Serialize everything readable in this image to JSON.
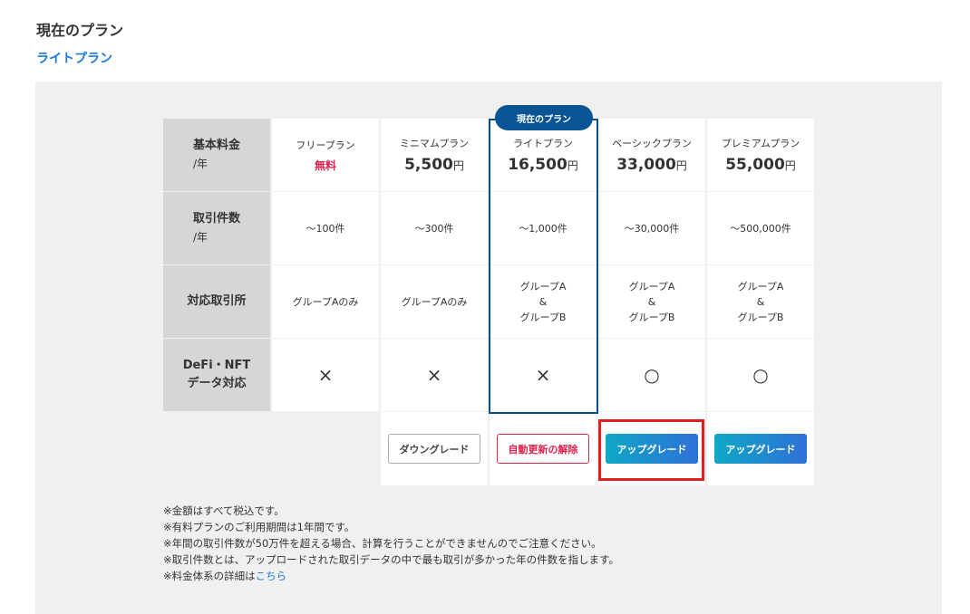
{
  "header": {
    "title": "現在のプラン",
    "current_plan": "ライトプラン"
  },
  "badge": "現在のプラン",
  "row_headers": {
    "base_fee": {
      "main": "基本料金",
      "sub": "/年"
    },
    "transactions": {
      "main": "取引件数",
      "sub": "/年"
    },
    "exchanges": {
      "main": "対応取引所"
    },
    "defi": {
      "line1": "DeFi・NFT",
      "line2": "データ対応"
    }
  },
  "plans": [
    {
      "name": "フリープラン",
      "price": "無料",
      "yen": "",
      "transactions": "〜100件",
      "exchanges": [
        "グループAのみ"
      ],
      "defi": "×"
    },
    {
      "name": "ミニマムプラン",
      "price": "5,500",
      "yen": "円",
      "transactions": "〜300件",
      "exchanges": [
        "グループAのみ"
      ],
      "defi": "×"
    },
    {
      "name": "ライトプラン",
      "price": "16,500",
      "yen": "円",
      "transactions": "〜1,000件",
      "exchanges": [
        "グループA",
        "&",
        "グループB"
      ],
      "defi": "×"
    },
    {
      "name": "ベーシックプラン",
      "price": "33,000",
      "yen": "円",
      "transactions": "〜30,000件",
      "exchanges": [
        "グループA",
        "&",
        "グループB"
      ],
      "defi": "○"
    },
    {
      "name": "プレミアムプラン",
      "price": "55,000",
      "yen": "円",
      "transactions": "〜500,000件",
      "exchanges": [
        "グループA",
        "&",
        "グループB"
      ],
      "defi": "○"
    }
  ],
  "buttons": {
    "downgrade": "ダウングレード",
    "cancel_renewal": "自動更新の解除",
    "upgrade_basic": "アップグレード",
    "upgrade_premium": "アップグレード"
  },
  "notes": {
    "line1": "※金額はすべて税込です。",
    "line2": "※有料プランのご利用期間は1年間です。",
    "line3": "※年間の取引件数が50万件を超える場合、計算を行うことができませんのでご注意ください。",
    "line4": "※取引件数とは、アップロードされた取引データの中で最も取引が多かった年の件数を指します。",
    "line5_prefix": "※料金体系の詳細は",
    "line5_link": "こちら"
  },
  "colors": {
    "accent": "#1a7bd6",
    "current_frame": "#0a4f8a",
    "free": "#e0234e",
    "highlight": "#e0201f"
  }
}
